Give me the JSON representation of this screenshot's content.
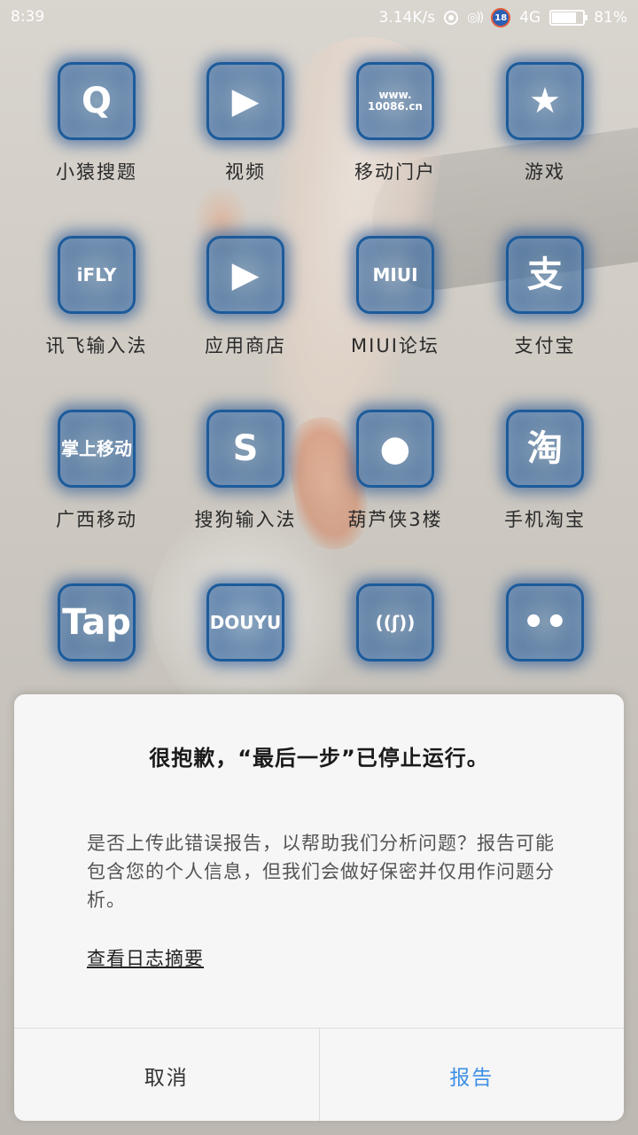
{
  "status_bar": {
    "time": "8:39",
    "net_speed": "3.14K/s",
    "badge": "18",
    "network": "4G",
    "battery_percent": 81,
    "battery_label": "81%"
  },
  "apps": [
    {
      "label": "小猿搜题",
      "icon": "search-q-icon",
      "glyph": "Q"
    },
    {
      "label": "视频",
      "icon": "video-camera-icon",
      "glyph": "▶"
    },
    {
      "label": "移动门户",
      "icon": "portal-cursor-icon",
      "glyph": "www.\n10086.cn"
    },
    {
      "label": "游戏",
      "icon": "star-icon",
      "glyph": "★"
    },
    {
      "label": "讯飞输入法",
      "icon": "ifly-icon",
      "glyph": "iFLY"
    },
    {
      "label": "应用商店",
      "icon": "store-bag-icon",
      "glyph": "▶"
    },
    {
      "label": "MIUI论坛",
      "icon": "miui-forum-icon",
      "glyph": "MIUI"
    },
    {
      "label": "支付宝",
      "icon": "alipay-icon",
      "glyph": "支"
    },
    {
      "label": "广西移动",
      "icon": "china-mobile-icon",
      "glyph": "掌上移动"
    },
    {
      "label": "搜狗输入法",
      "icon": "sogou-icon",
      "glyph": "S"
    },
    {
      "label": "葫芦侠3楼",
      "icon": "gourd-icon",
      "glyph": "●"
    },
    {
      "label": "手机淘宝",
      "icon": "taobao-icon",
      "glyph": "淘"
    },
    {
      "label": "",
      "icon": "taptap-icon",
      "glyph": "Tap"
    },
    {
      "label": "",
      "icon": "douyu-icon",
      "glyph": "DOUYU"
    },
    {
      "label": "",
      "icon": "wifi-signal-icon",
      "glyph": "((ʃ))"
    },
    {
      "label": "",
      "icon": "wechat-icon",
      "glyph": "••"
    }
  ],
  "dialog": {
    "title": "很抱歉，“最后一步”已停止运行。",
    "body": "是否上传此错误报告，以帮助我们分析问题？报告可能包含您的个人信息，但我们会做好保密并仅用作问题分析。",
    "link": "查看日志摘要",
    "cancel_label": "取消",
    "report_label": "报告",
    "report_color": "#3d8fe6"
  }
}
